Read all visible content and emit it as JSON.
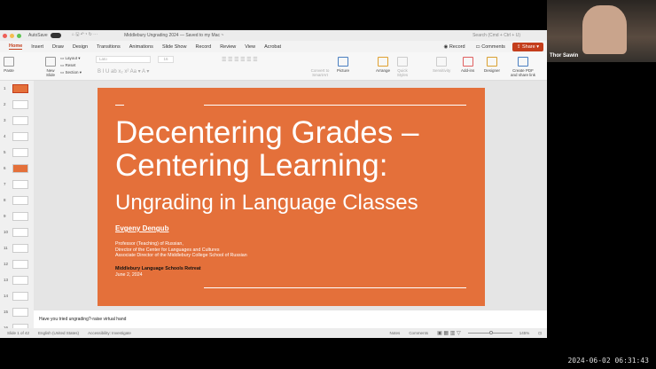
{
  "window": {
    "autosave": "AutoSave",
    "doc_title": "Middlebury Ungrading 2024 — Saved to my Mac ~",
    "search_placeholder": "Search (Cmd + Ctrl + U)"
  },
  "tabs": [
    "Home",
    "Insert",
    "Draw",
    "Design",
    "Transitions",
    "Animations",
    "Slide Show",
    "Record",
    "Review",
    "View",
    "Acrobat"
  ],
  "actions": {
    "record": "Record",
    "comments": "Comments",
    "share": "Share"
  },
  "ribbon": {
    "paste": "Paste",
    "new_slide": "New Slide",
    "layout": "Layout",
    "reset": "Reset",
    "section": "Section",
    "font": "Lato",
    "font_size": "16",
    "convert": "Convert to SmartArt",
    "picture": "Picture",
    "arrange": "Arrange",
    "quick_styles": "Quick Styles",
    "sensitivity": "Sensitivity",
    "addins": "Add-ins",
    "designer": "Designer",
    "create_pdf": "Create PDF and share link"
  },
  "thumbnails": [
    "1",
    "2",
    "3",
    "4",
    "5",
    "6",
    "7",
    "8",
    "9",
    "10",
    "11",
    "12",
    "13",
    "14",
    "15",
    "16"
  ],
  "slide": {
    "title1": "Decentering Grades –",
    "title2": "Centering Learning:",
    "subtitle": "Ungrading  in Language Classes",
    "author": "Evgeny Dengub",
    "role1": "Professor (Teaching) of Russian,",
    "role2": "Director of the Center for Languages and Cultures",
    "role3": "Associate Director of the Middlebury College School of Russian",
    "event": "Middlebury Language Schools Retreat",
    "date": "June 2, 2024"
  },
  "notes": "Have you tried ungrading?-raise virtual hand",
  "status": {
    "slide": "Slide 1 of 42",
    "lang": "English (United States)",
    "accessibility": "Accessibility: Investigate",
    "notes": "Notes",
    "comments": "Comments",
    "zoom": "145%"
  },
  "participant": "Thor Sawin",
  "timestamp": "2024-06-02 06:31:43",
  "colors": {
    "accent": "#c43e1c",
    "slide": "#e4703a"
  }
}
